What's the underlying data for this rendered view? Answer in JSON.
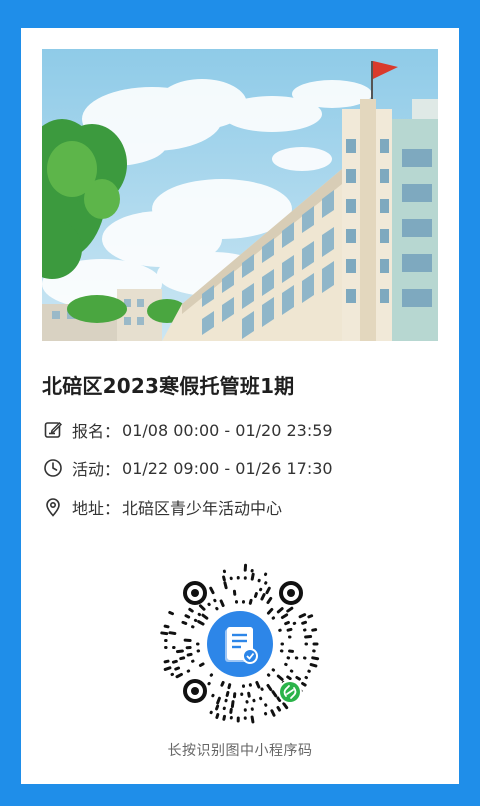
{
  "event": {
    "title": "北碚区2023寒假托管班1期",
    "registration": {
      "label": "报名：",
      "value": "01/08 00:00 - 01/20 23:59",
      "icon": "edit-note-icon"
    },
    "activity": {
      "label": "活动：",
      "value": "01/22 09:00 - 01/26 17:30",
      "icon": "clock-icon"
    },
    "address": {
      "label": "地址：",
      "value": "北碚区青少年活动中心",
      "icon": "location-pin-icon"
    }
  },
  "miniprogram": {
    "footer_text": "长按识别图中小程序码",
    "center_icon": "document-check-icon",
    "badge_icon": "mini-program-link-icon"
  },
  "colors": {
    "background": "#1f8ee9",
    "card": "#ffffff",
    "qr_center": "#2d86e8",
    "badge": "#2bb34a"
  }
}
